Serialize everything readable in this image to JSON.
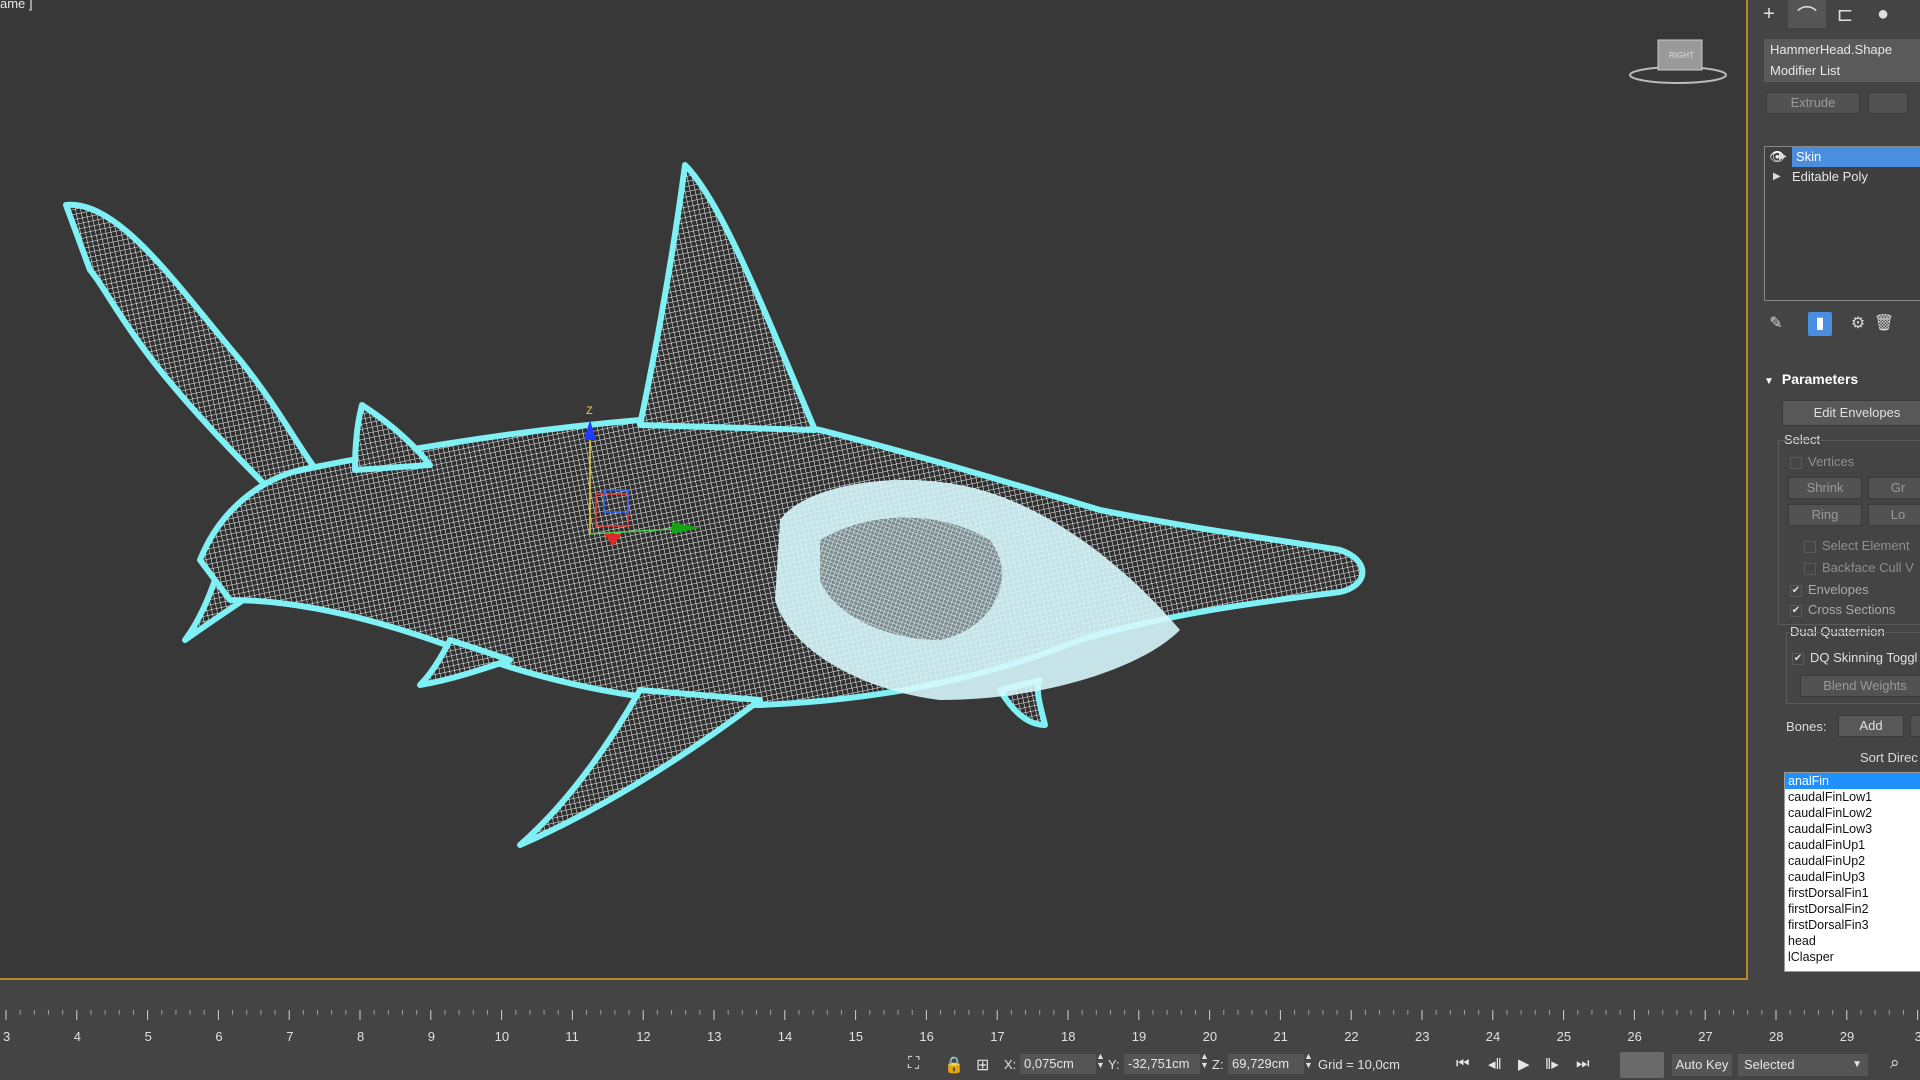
{
  "viewport": {
    "label": "ame ]",
    "viewcube_label": "RIGHT",
    "gizmo_axis_label": "Z"
  },
  "panel": {
    "tabs": [
      "create-icon",
      "modify-icon",
      "hierarchy-icon",
      "display-icon"
    ],
    "object_name": "HammerHead.Shape",
    "modifier_list": "Modifier List",
    "extrude_label": "Extrude",
    "stack": [
      {
        "label": "Skin",
        "selected": true
      },
      {
        "label": "Editable Poly",
        "selected": false
      }
    ],
    "parameters_title": "Parameters",
    "edit_envelopes": "Edit Envelopes",
    "select_group": "Select",
    "vertices": "Vertices",
    "shrink": "Shrink",
    "grow": "Gr",
    "ring": "Ring",
    "loop": "Lo",
    "select_element": "Select Element",
    "backface_cull": "Backface Cull V",
    "envelopes": "Envelopes",
    "cross_sections": "Cross Sections",
    "dual_quaternion": "Dual Quaternion",
    "dq_toggle": "DQ Skinning Toggl",
    "blend_weights": "Blend Weights",
    "bones_label": "Bones:",
    "add_label": "Add",
    "sort_label": "Sort Direc",
    "bones": [
      "analFin",
      "caudalFinLow1",
      "caudalFinLow2",
      "caudalFinLow3",
      "caudalFinUp1",
      "caudalFinUp2",
      "caudalFinUp3",
      "firstDorsalFin1",
      "firstDorsalFin2",
      "firstDorsalFin3",
      "head",
      "lClasper"
    ],
    "selected_bone": "analFin"
  },
  "timeline": {
    "ticks": [
      "3",
      "4",
      "5",
      "6",
      "7",
      "8",
      "9",
      "10",
      "11",
      "12",
      "13",
      "14",
      "15",
      "16",
      "17",
      "18",
      "19",
      "20",
      "21",
      "22",
      "23",
      "24",
      "25",
      "26",
      "27",
      "28",
      "29",
      "3"
    ]
  },
  "status": {
    "x_label": "X:",
    "x_value": "0,075cm",
    "y_label": "Y:",
    "y_value": "-32,751cm",
    "z_label": "Z:",
    "z_value": "69,729cm",
    "grid": "Grid = 10,0cm",
    "auto_key": "Auto Key",
    "selected": "Selected"
  },
  "colors": {
    "viewport_bg": "#383838",
    "wire": "#ffffff",
    "outline": "#7ff1f5",
    "selection_blue": "#4a8ee2",
    "viewport_border": "#b48a2e"
  }
}
